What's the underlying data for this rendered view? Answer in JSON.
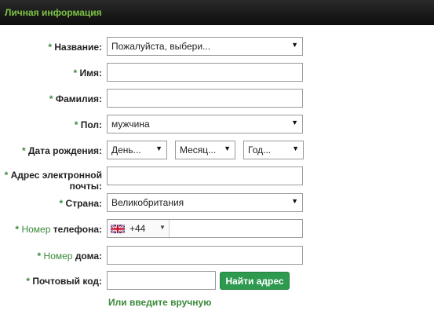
{
  "section": {
    "title": "Личная информация"
  },
  "required_mark": "*",
  "fields": {
    "title": {
      "label": "Название:",
      "value": "Пожалуйста, выбери..."
    },
    "first_name": {
      "label": "Имя:",
      "value": ""
    },
    "last_name": {
      "label": "Фамилия:",
      "value": ""
    },
    "gender": {
      "label": "Пол:",
      "value": "мужчина"
    },
    "dob": {
      "label": "Дата рождения:",
      "day": "День...",
      "month": "Месяц...",
      "year": "Год..."
    },
    "email": {
      "label_line1": "Адрес электронной",
      "label_line2": "почты:",
      "value": ""
    },
    "country": {
      "label": "Страна:",
      "value": "Великобритания"
    },
    "phone": {
      "label_prefix": "Номер",
      "label_suffix": "телефона:",
      "country_code": "+44",
      "flag": "uk-flag-icon",
      "value": ""
    },
    "house": {
      "label_prefix": "Номер",
      "label_suffix": "дома:",
      "value": ""
    },
    "postcode": {
      "label": "Почтовый код:",
      "value": ""
    }
  },
  "find_address_button": "Найти адрес",
  "manual_link": "Или введите вручную",
  "icons": {
    "dropdown": "triangle-down-icon"
  },
  "colors": {
    "accent_green": "#3a8a3a",
    "header_text": "#7cc344",
    "button_bg": "#2d9a4f",
    "header_bg": "#111111"
  }
}
